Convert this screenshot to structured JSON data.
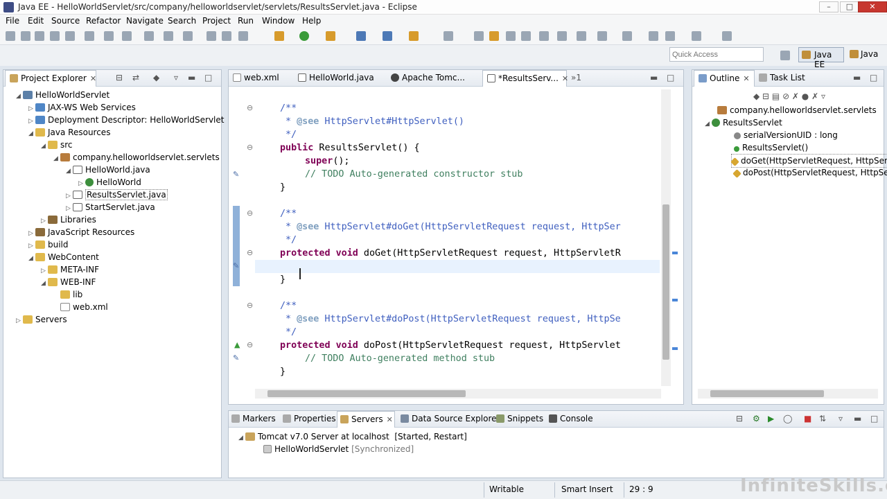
{
  "window": {
    "title": "Java EE - HelloWorldServlet/src/company/helloworldservlet/servlets/ResultsServlet.java - Eclipse"
  },
  "menu": [
    "File",
    "Edit",
    "Source",
    "Refactor",
    "Navigate",
    "Search",
    "Project",
    "Run",
    "Window",
    "Help"
  ],
  "quick_access": {
    "placeholder": "Quick Access"
  },
  "perspectives": [
    "Java EE",
    "Java"
  ],
  "project_explorer": {
    "title": "Project Explorer",
    "items": [
      {
        "label": "HelloWorldServlet"
      },
      {
        "label": "JAX-WS Web Services"
      },
      {
        "label": "Deployment Descriptor: HelloWorldServlet"
      },
      {
        "label": "Java Resources"
      },
      {
        "label": "src"
      },
      {
        "label": "company.helloworldservlet.servlets"
      },
      {
        "label": "HelloWorld.java"
      },
      {
        "label": "HelloWorld"
      },
      {
        "label": "ResultsServlet.java"
      },
      {
        "label": "StartServlet.java"
      },
      {
        "label": "Libraries"
      },
      {
        "label": "JavaScript Resources"
      },
      {
        "label": "build"
      },
      {
        "label": "WebContent"
      },
      {
        "label": "META-INF"
      },
      {
        "label": "WEB-INF"
      },
      {
        "label": "lib"
      },
      {
        "label": "web.xml"
      },
      {
        "label": "Servers"
      }
    ]
  },
  "editor": {
    "tabs": [
      "web.xml",
      "HelloWorld.java",
      "Apache Tomc...",
      "*ResultsServ..."
    ],
    "overflow_count": "1",
    "lines": {
      "l1": "/**",
      "l2_at": "@see",
      "l2_rest": " HttpServlet#HttpServlet()",
      "l3": "*/",
      "l4_kw": "public",
      "l4_rest": " ResultsServlet() {",
      "l5_kw": "super",
      "l5_rest": "();",
      "l6": "// TODO Auto-generated constructor stub",
      "l7": "}",
      "l8": "/**",
      "l9_at": "@see",
      "l9_rest": " HttpServlet#doGet(HttpServletRequest request, HttpSer",
      "l10": "*/",
      "l11_kw": "protected void",
      "l11_rest": " doGet(HttpServletRequest request, HttpServletR",
      "l12": "}",
      "l13": "/**",
      "l14_at": "@see",
      "l14_rest": " HttpServlet#doPost(HttpServletRequest request, HttpSe",
      "l15": "*/",
      "l16_kw": "protected void",
      "l16_rest": " doPost(HttpServletRequest request, HttpServlet",
      "l17": "// TODO Auto-generated method stub",
      "l18": "}"
    }
  },
  "outline": {
    "tabs": [
      "Outline",
      "Task List"
    ],
    "items": [
      {
        "label": "company.helloworldservlet.servlets"
      },
      {
        "label": "ResultsServlet"
      },
      {
        "label": "serialVersionUID : long"
      },
      {
        "label": "ResultsServlet()"
      },
      {
        "label": "doGet(HttpServletRequest, HttpSen"
      },
      {
        "label": "doPost(HttpServletRequest, HttpSe"
      }
    ]
  },
  "bottom_panel": {
    "tabs": [
      "Markers",
      "Properties",
      "Servers",
      "Data Source Explorer",
      "Snippets",
      "Console"
    ],
    "server": {
      "name": "Tomcat v7.0 Server at localhost",
      "state": "[Started, Restart]"
    },
    "module": {
      "name": "HelloWorldServlet",
      "state": "[Synchronized]"
    }
  },
  "status": {
    "writable": "Writable",
    "insert_mode": "Smart Insert",
    "position": "29 : 9"
  },
  "watermark": "InfiniteSkills.com"
}
